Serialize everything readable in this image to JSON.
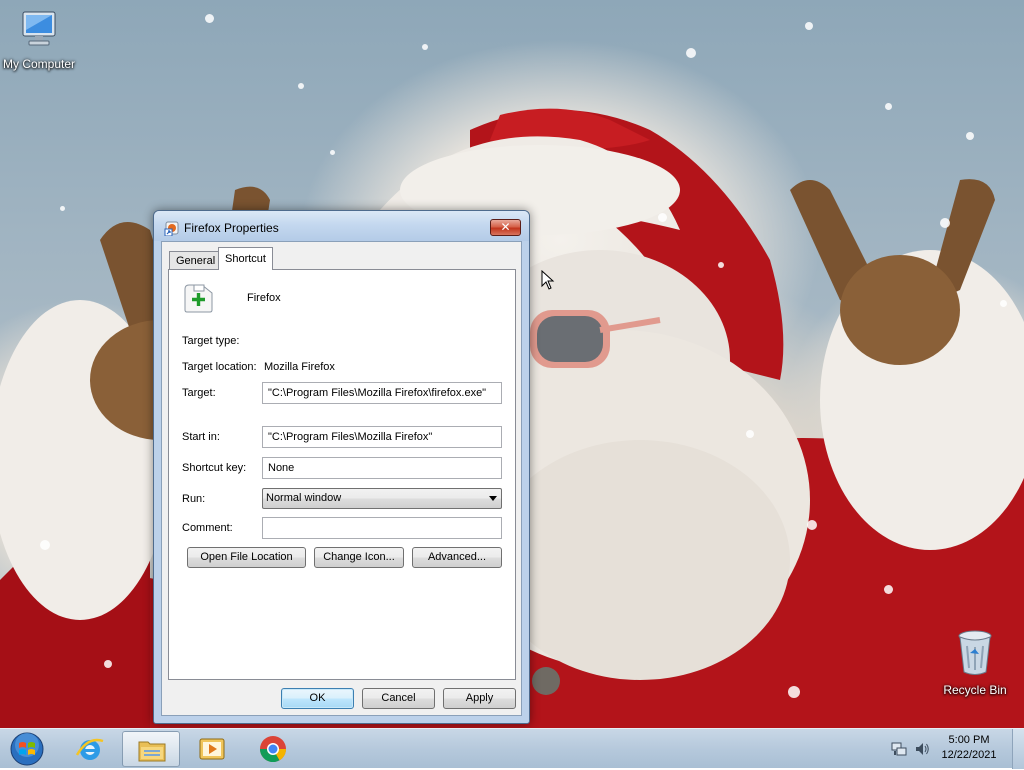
{
  "desktop": {
    "icons": [
      {
        "label": "My Computer",
        "icon": "computer-icon"
      },
      {
        "label": "Recycle Bin",
        "icon": "recycle-bin-icon"
      }
    ]
  },
  "dialog": {
    "title": "Firefox Properties",
    "close_label": "✕",
    "tabs": [
      {
        "label": "General",
        "selected": false
      },
      {
        "label": "Shortcut",
        "selected": true
      }
    ],
    "shortcut": {
      "name": "Firefox",
      "target_type_label": "Target type:",
      "target_type_value": "",
      "target_location_label": "Target location:",
      "target_location_value": "Mozilla Firefox",
      "target_label": "Target:",
      "target_value": "\"C:\\Program Files\\Mozilla Firefox\\firefox.exe\"",
      "start_in_label": "Start in:",
      "start_in_value": "\"C:\\Program Files\\Mozilla Firefox\"",
      "shortcut_key_label": "Shortcut key:",
      "shortcut_key_value": "None",
      "run_label": "Run:",
      "run_value": "Normal window",
      "comment_label": "Comment:",
      "comment_value": "",
      "open_file_location_label": "Open File Location",
      "change_icon_label": "Change Icon...",
      "advanced_label": "Advanced..."
    },
    "ok_label": "OK",
    "cancel_label": "Cancel",
    "apply_label": "Apply"
  },
  "taskbar": {
    "items": [
      {
        "icon": "start-orb-icon"
      },
      {
        "icon": "internet-explorer-icon"
      },
      {
        "icon": "file-explorer-icon",
        "active": true
      },
      {
        "icon": "media-player-icon"
      },
      {
        "icon": "chrome-icon"
      }
    ],
    "tray_icons": [
      "network-icon",
      "volume-icon"
    ],
    "time": "5:00 PM",
    "date": "12/22/2021"
  },
  "colors": {
    "taskbar": "#b6c9dc",
    "dialog_frame": "#bcd1ea",
    "close_button": "#c2361d",
    "santa_red": "#b3141a"
  }
}
